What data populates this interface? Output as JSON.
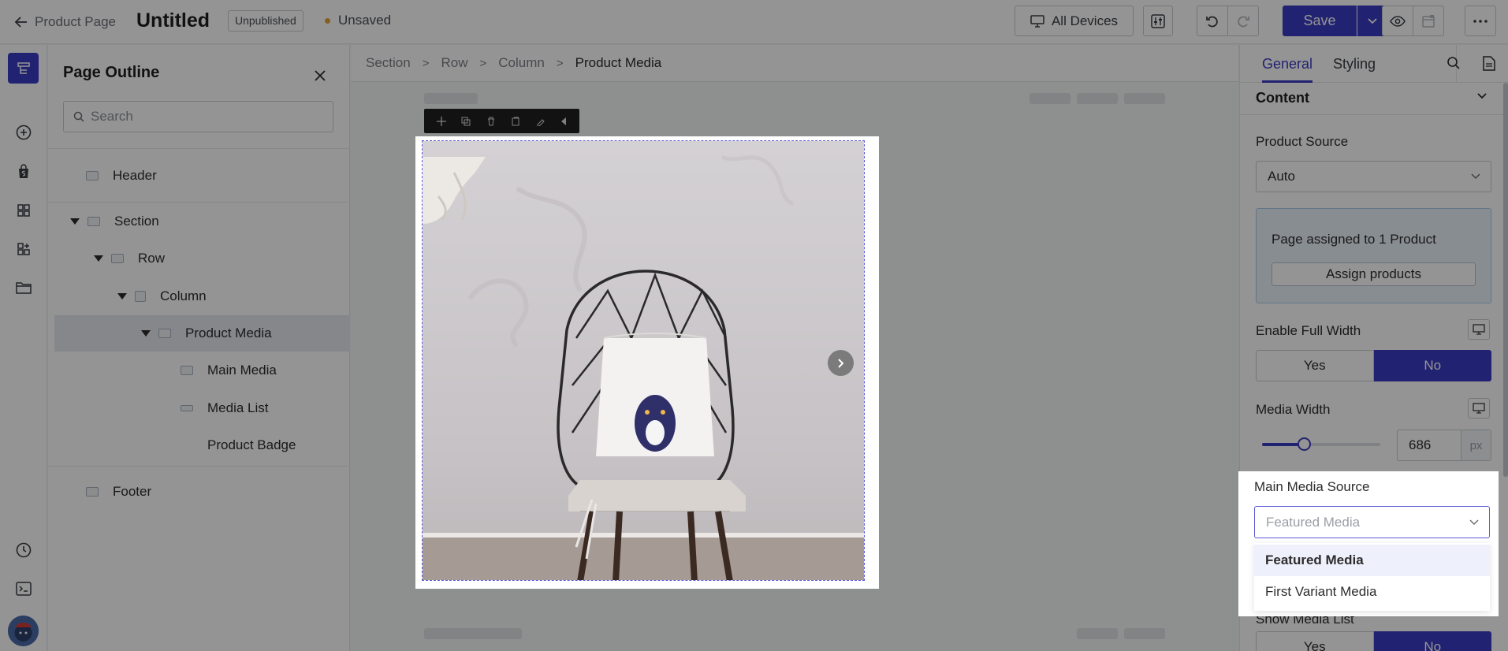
{
  "topbar": {
    "back_label": "Product Page",
    "title": "Untitled",
    "status_badge": "Unpublished",
    "save_state": "Unsaved",
    "devices_label": "All Devices",
    "save_label": "Save"
  },
  "outline": {
    "title": "Page Outline",
    "search_placeholder": "Search",
    "items": [
      {
        "label": "Header"
      },
      {
        "label": "Section"
      },
      {
        "label": "Row"
      },
      {
        "label": "Column"
      },
      {
        "label": "Product Media"
      },
      {
        "label": "Main Media"
      },
      {
        "label": "Media List"
      },
      {
        "label": "Product Badge"
      },
      {
        "label": "Footer"
      }
    ]
  },
  "breadcrumb": [
    "Section",
    "Row",
    "Column",
    "Product Media"
  ],
  "props": {
    "tabs": [
      "General",
      "Styling"
    ],
    "section_title": "Content",
    "product_source_label": "Product Source",
    "product_source_value": "Auto",
    "info_text": "Page assigned to 1 Product",
    "assign_button": "Assign products",
    "full_width_label": "Enable Full Width",
    "yes": "Yes",
    "no": "No",
    "media_width_label": "Media Width",
    "media_width_value": "686",
    "media_width_unit": "px",
    "media_width_slider_fraction": 0.35,
    "main_media_source_label": "Main Media Source",
    "main_media_source_placeholder": "Featured Media",
    "main_media_source_options": [
      "Featured Media",
      "First Variant Media"
    ],
    "show_media_list_label": "Show Media List"
  },
  "colors": {
    "accent": "#3c3cc4",
    "info_bg": "#eaf3fc",
    "unsaved_dot": "#e8a33c"
  }
}
